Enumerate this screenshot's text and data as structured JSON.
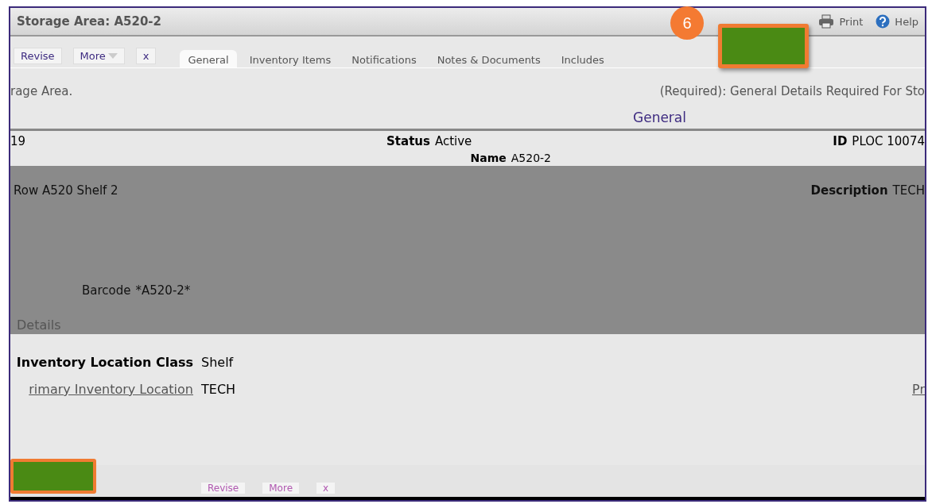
{
  "window": {
    "title": "Storage Area: A520-2"
  },
  "header_links": [
    {
      "label": "Print"
    },
    {
      "label": "Help"
    }
  ],
  "callout": {
    "number": "6"
  },
  "actions": [
    {
      "label": "Revise",
      "kind": "plain"
    },
    {
      "label": "More",
      "kind": "menu"
    },
    {
      "label": "x",
      "kind": "plain"
    }
  ],
  "tabs": [
    {
      "label": "General",
      "selected": true
    },
    {
      "label": "Inventory Items",
      "selected": false
    },
    {
      "label": "Notifications",
      "selected": false
    },
    {
      "label": "Notes & Documents",
      "selected": false
    },
    {
      "label": "Includes",
      "selected": false
    }
  ],
  "intro": {
    "left": "rage Area.",
    "right": "(Required): General Details Required For Sto"
  },
  "section_title": "General",
  "general_fields": [
    {
      "value": "19"
    },
    {
      "label": "Status",
      "value": "Active"
    },
    {
      "label": "ID",
      "value": "PLOC 10074"
    }
  ],
  "name_field": {
    "label": "Name",
    "value": "A520-2"
  },
  "row_field": {
    "value": "Row A520 Shelf 2"
  },
  "description": {
    "label": "Description",
    "value": "TECH"
  },
  "barcode": {
    "label": "Barcode",
    "value": "*A520-2*"
  },
  "details": {
    "title": "Details",
    "rows": [
      {
        "label": "Inventory Location Class",
        "value": "Shelf",
        "kind": "label"
      },
      {
        "label": "rimary Inventory Location",
        "value": "TECH",
        "kind": "link"
      }
    ],
    "side_link": "Pr"
  },
  "footer_actions": [
    {
      "label": "Revise"
    },
    {
      "label": "More"
    },
    {
      "label": "x"
    }
  ]
}
